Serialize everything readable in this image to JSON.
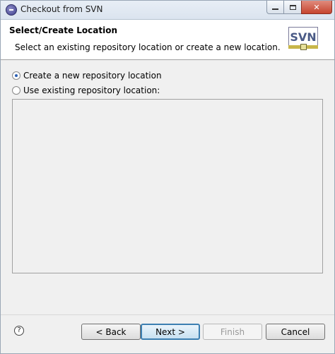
{
  "window": {
    "title": "Checkout from SVN"
  },
  "header": {
    "title": "Select/Create Location",
    "description": "Select an existing repository location or create a new location.",
    "logo_text": "SVN"
  },
  "options": [
    {
      "label": "Create a new repository location",
      "checked": true
    },
    {
      "label": "Use existing repository location:",
      "checked": false
    }
  ],
  "buttons": {
    "back": "< Back",
    "next": "Next >",
    "finish": "Finish",
    "cancel": "Cancel",
    "help": "?"
  },
  "icons": {
    "app": "eclipse-icon",
    "help": "help-icon",
    "minimize": "minimize-icon",
    "maximize": "maximize-icon",
    "close": "close-icon"
  }
}
